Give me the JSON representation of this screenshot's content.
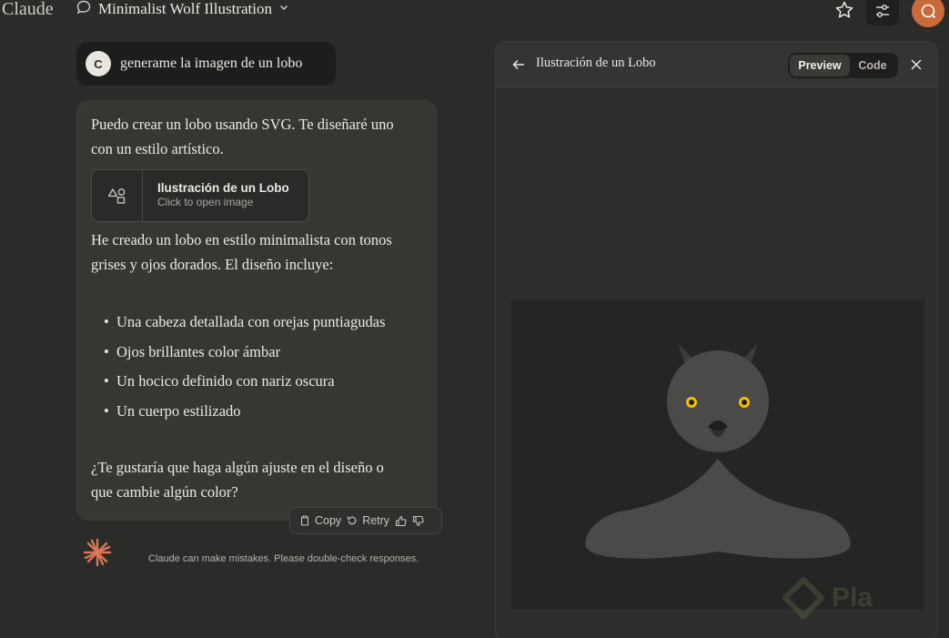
{
  "app": {
    "logo_text": "Claude"
  },
  "header": {
    "conversation_title": "Minimalist Wolf Illustration"
  },
  "user_message": {
    "avatar_initial": "C",
    "text": "generame la imagen de un lobo"
  },
  "assistant_message": {
    "intro": "Puedo crear un lobo usando SVG. Te diseñaré uno con un estilo artístico.",
    "artifact_card": {
      "title": "Ilustración de un Lobo",
      "subtitle": "Click to open image"
    },
    "paragraph2": "He creado un lobo en estilo minimalista con tonos grises y ojos dorados. El diseño incluye:",
    "bullets": [
      "Una cabeza detallada con orejas puntiagudas",
      "Ojos brillantes color ámbar",
      "Un hocico definido con nariz oscura",
      "Un cuerpo estilizado"
    ],
    "closing": "¿Te gustaría que haga algún ajuste en el diseño o que cambie algún color?"
  },
  "actions": {
    "copy": "Copy",
    "retry": "Retry"
  },
  "disclaimer": "Claude can make mistakes. Please double-check responses.",
  "panel": {
    "title": "Ilustración de un Lobo",
    "tabs": {
      "preview": "Preview",
      "code": "Code"
    },
    "active_tab": "Preview"
  },
  "colors": {
    "background": "#2b2b29",
    "accent": "#c96a3a",
    "wolf_gray": "#4a4a48",
    "wolf_eye": "#f2c200",
    "canvas": "#252524"
  },
  "watermark": {
    "text": "Pla"
  }
}
